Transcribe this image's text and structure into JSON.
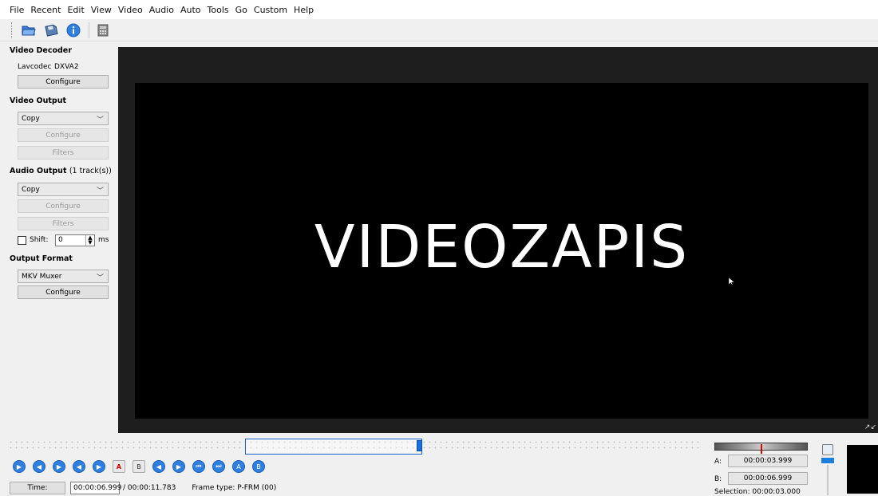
{
  "menu": [
    "File",
    "Recent",
    "Edit",
    "View",
    "Video",
    "Audio",
    "Auto",
    "Tools",
    "Go",
    "Custom",
    "Help"
  ],
  "toolbar": {
    "icons": [
      "open-folder-icon",
      "save-icon",
      "info-icon",
      "calculator-icon"
    ]
  },
  "video_decoder": {
    "title": "Video Decoder",
    "decoder": "Lavcodec",
    "accel": "DXVA2",
    "configure": "Configure"
  },
  "video_output": {
    "title": "Video Output",
    "codec": "Copy",
    "configure": "Configure",
    "filters": "Filters"
  },
  "audio_output": {
    "title": "Audio Output",
    "tracks": "(1 track(s))",
    "codec": "Copy",
    "configure": "Configure",
    "filters": "Filters",
    "shift_label": "Shift:",
    "shift_value": "0",
    "shift_unit": "ms"
  },
  "output_format": {
    "title": "Output Format",
    "muxer": "MKV Muxer",
    "configure": "Configure"
  },
  "video": {
    "text": "VIDEOZAPIS"
  },
  "timeline": {
    "position_fraction": 0.596,
    "selection_start_fraction": 0.34,
    "selection_end_fraction": 0.596
  },
  "transport": {
    "buttons": [
      "play",
      "prev-frame",
      "next-frame",
      "prev-keyframe",
      "next-keyframe",
      "set-marker-a",
      "set-marker-b",
      "prev-black",
      "next-black",
      "goto-first",
      "goto-last",
      "goto-marker-a",
      "goto-marker-b"
    ]
  },
  "status": {
    "time_label": "Time:",
    "current_time": "00:00:06.999",
    "total_time": "/ 00:00:11.783",
    "frame_type": "Frame type: P-FRM (00)"
  },
  "selection": {
    "a_label": "A:",
    "a_time": "00:00:03.999",
    "b_label": "B:",
    "b_time": "00:00:06.999",
    "selection": "Selection: 00:00:03.000"
  },
  "colors": {
    "accent": "#2f7fe0",
    "video_bg": "#000000",
    "panel_bg": "#f0f0f0"
  }
}
